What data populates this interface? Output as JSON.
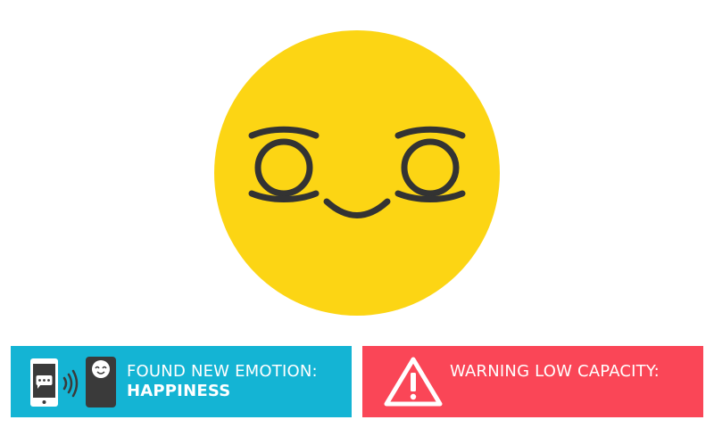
{
  "colors": {
    "face": "#fcd514",
    "face_features": "#333333",
    "info_panel": "#14b4d4",
    "warning_panel": "#fa4657",
    "panel_text": "#ffffff"
  },
  "face": {
    "icon": "happy-face-icon"
  },
  "status": {
    "icon": "phone-to-robot-transfer-icon",
    "label": "FOUND NEW EMOTION:",
    "emotion": "HAPPINESS"
  },
  "warning": {
    "icon": "warning-triangle-icon",
    "label": "WARNING LOW CAPACITY:",
    "value": ""
  }
}
